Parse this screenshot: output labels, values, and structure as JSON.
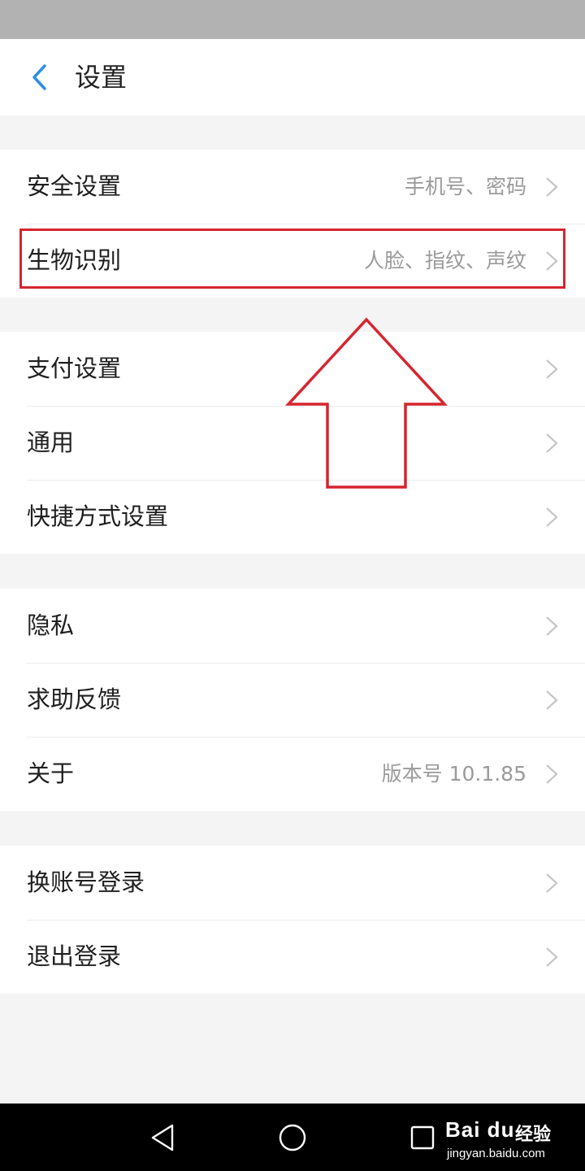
{
  "header": {
    "title": "设置"
  },
  "groups": [
    {
      "items": [
        {
          "label": "安全设置",
          "value": "手机号、密码"
        },
        {
          "label": "生物识别",
          "value": "人脸、指纹、声纹"
        }
      ]
    },
    {
      "items": [
        {
          "label": "支付设置",
          "value": ""
        },
        {
          "label": "通用",
          "value": ""
        },
        {
          "label": "快捷方式设置",
          "value": ""
        }
      ]
    },
    {
      "items": [
        {
          "label": "隐私",
          "value": ""
        },
        {
          "label": "求助反馈",
          "value": ""
        },
        {
          "label": "关于",
          "value": "版本号 10.1.85"
        }
      ]
    },
    {
      "items": [
        {
          "label": "换账号登录",
          "value": ""
        },
        {
          "label": "退出登录",
          "value": ""
        }
      ]
    }
  ],
  "icons": {
    "back": "chevron-left-icon",
    "row_arrow": "chevron-right-icon",
    "nav": [
      "back-triangle-icon",
      "home-circle-icon",
      "recents-square-icon"
    ]
  },
  "colors": {
    "accent": "#2d8ee0",
    "annotation": "#d6252f",
    "status_bar": "#b2b2b2",
    "background": "#f4f4f4"
  },
  "watermark": {
    "logo": "Bai du",
    "text": "经验",
    "url": "jingyan.baidu.com"
  }
}
